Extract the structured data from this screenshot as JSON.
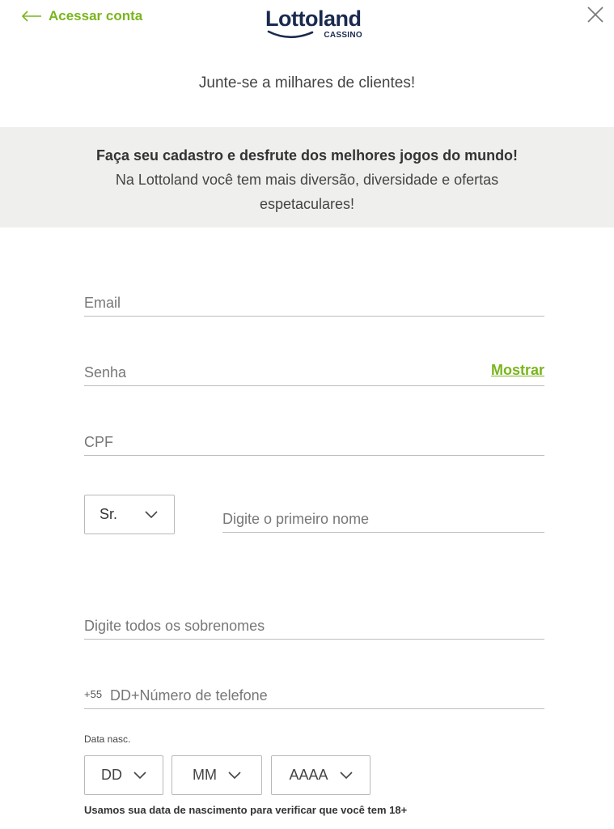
{
  "header": {
    "back_label": "Acessar conta",
    "logo_word": "Lottoland",
    "logo_sub": "CASSINO",
    "accent_color": "#7ab51d",
    "brand_color": "#1a2a4f",
    "icons": {
      "back": "arrow-left-icon",
      "close": "close-icon",
      "chevron": "chevron-down-icon"
    }
  },
  "intro": {
    "join_text": "Junte-se a milhares de clientes!"
  },
  "banner": {
    "title": "Faça seu cadastro e desfrute dos melhores jogos do mundo!",
    "body": "Na Lottoland você tem mais diversão, diversidade e ofertas espetaculares!"
  },
  "form": {
    "email_placeholder": "Email",
    "password_placeholder": "Senha",
    "show_label": "Mostrar",
    "cpf_placeholder": "CPF",
    "title_value": "Sr.",
    "first_name_placeholder": "Digite o primeiro nome",
    "last_name_placeholder": "Digite todos os sobrenomes",
    "phone_prefix": "+55",
    "phone_placeholder": "DD+Número de telefone",
    "dob_label": "Data nasc.",
    "dob_day": "DD",
    "dob_month": "MM",
    "dob_year": "AAAA",
    "dob_note": "Usamos sua data de nascimento para verificar que você tem 18+"
  }
}
